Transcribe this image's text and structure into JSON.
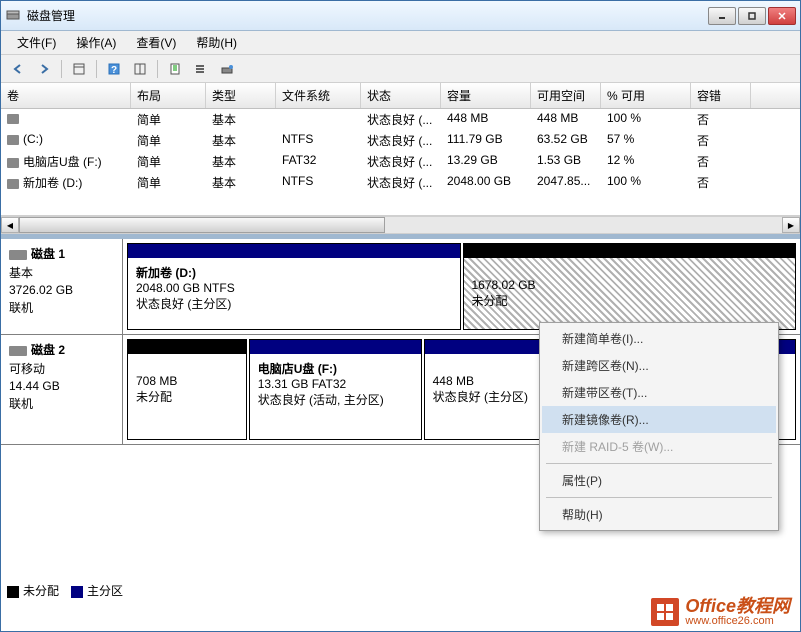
{
  "window": {
    "title": "磁盘管理"
  },
  "menubar": [
    "文件(F)",
    "操作(A)",
    "查看(V)",
    "帮助(H)"
  ],
  "vol_headers": [
    "卷",
    "布局",
    "类型",
    "文件系统",
    "状态",
    "容量",
    "可用空间",
    "% 可用",
    "容错"
  ],
  "volumes": [
    {
      "name": "",
      "layout": "简单",
      "type": "基本",
      "fs": "",
      "status": "状态良好 (...",
      "cap": "448 MB",
      "free": "448 MB",
      "pct": "100 %",
      "ft": "否"
    },
    {
      "name": "(C:)",
      "layout": "简单",
      "type": "基本",
      "fs": "NTFS",
      "status": "状态良好 (...",
      "cap": "111.79 GB",
      "free": "63.52 GB",
      "pct": "57 %",
      "ft": "否"
    },
    {
      "name": "电脑店U盘 (F:)",
      "layout": "简单",
      "type": "基本",
      "fs": "FAT32",
      "status": "状态良好 (...",
      "cap": "13.29 GB",
      "free": "1.53 GB",
      "pct": "12 %",
      "ft": "否"
    },
    {
      "name": "新加卷 (D:)",
      "layout": "简单",
      "type": "基本",
      "fs": "NTFS",
      "status": "状态良好 (...",
      "cap": "2048.00 GB",
      "free": "2047.85...",
      "pct": "100 %",
      "ft": "否"
    }
  ],
  "disks": [
    {
      "name": "磁盘 1",
      "type": "基本",
      "size": "3726.02 GB",
      "status": "联机",
      "parts": [
        {
          "title": "新加卷  (D:)",
          "line2": "2048.00 GB NTFS",
          "line3": "状态良好 (主分区)",
          "head": "navy",
          "hatched": false,
          "width": "50%"
        },
        {
          "title": "",
          "line2": "1678.02 GB",
          "line3": "未分配",
          "head": "black",
          "hatched": true,
          "width": "50%"
        }
      ]
    },
    {
      "name": "磁盘 2",
      "type": "可移动",
      "size": "14.44 GB",
      "status": "联机",
      "parts": [
        {
          "title": "",
          "line2": "708 MB",
          "line3": "未分配",
          "head": "black",
          "hatched": false,
          "width": "18%"
        },
        {
          "title": "电脑店U盘  (F:)",
          "line2": "13.31 GB FAT32",
          "line3": "状态良好 (活动, 主分区)",
          "head": "navy",
          "hatched": false,
          "width": "26%"
        },
        {
          "title": "",
          "line2": "448 MB",
          "line3": "状态良好 (主分区)",
          "head": "navy",
          "hatched": false,
          "width": "56%"
        }
      ]
    }
  ],
  "ctxmenu": {
    "items": [
      {
        "label": "新建简单卷(I)...",
        "disabled": false
      },
      {
        "label": "新建跨区卷(N)...",
        "disabled": false
      },
      {
        "label": "新建带区卷(T)...",
        "disabled": false
      },
      {
        "label": "新建镜像卷(R)...",
        "disabled": false,
        "hover": true
      },
      {
        "label": "新建 RAID-5 卷(W)...",
        "disabled": true
      }
    ],
    "items2": [
      {
        "label": "属性(P)"
      }
    ],
    "items3": [
      {
        "label": "帮助(H)"
      }
    ]
  },
  "legend": {
    "unalloc": "未分配",
    "primary": "主分区"
  },
  "watermark": {
    "brand": "Office教程网",
    "url": "www.office26.com"
  }
}
